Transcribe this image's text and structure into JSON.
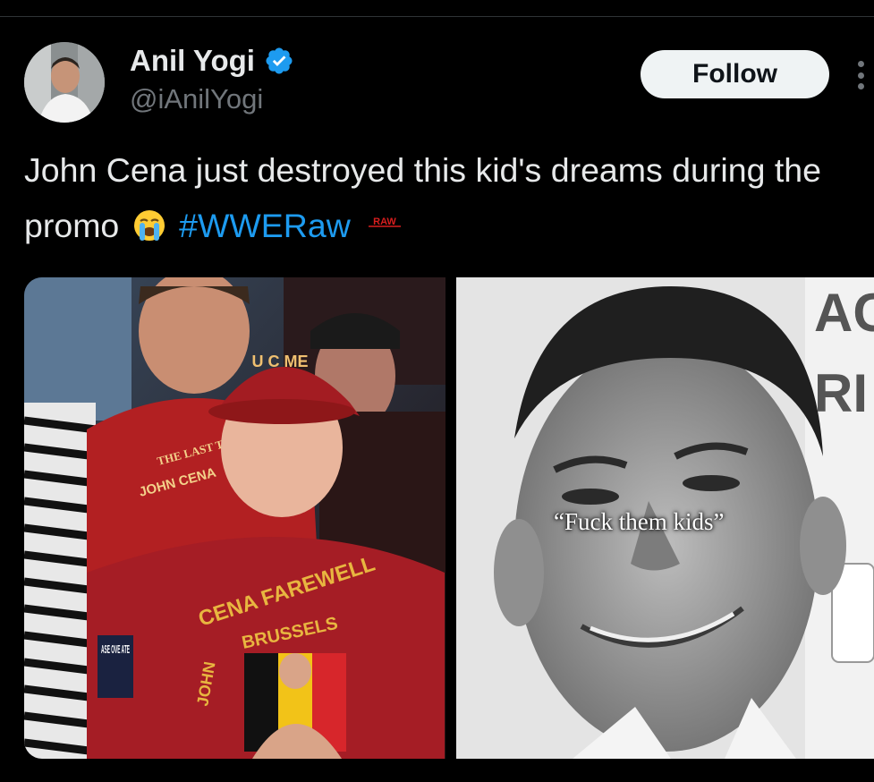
{
  "tweet": {
    "author": {
      "display_name": "Anil Yogi",
      "handle": "@iAnilYogi",
      "verified": true
    },
    "follow_label": "Follow",
    "text_main": "John Cena just destroyed this kid's dreams during the promo",
    "emoji": "loudly-crying-face",
    "hashtag": "#WWERaw",
    "hashtag_badge": "RAW",
    "media": {
      "left_image": {
        "cap_text": "U C ME",
        "shirt_text_top": "THE LAST TIME IS NOW",
        "shirt_text_name": "JOHN CENA",
        "kid_shirt_text_arc": "CENA FAREWELL",
        "kid_shirt_text_city": "BRUSSELS",
        "kid_shirt_text_side": "JOHN",
        "sign_text": "ASE OVE ATE"
      },
      "right_image": {
        "caption": "“Fuck them kids”"
      }
    }
  },
  "colors": {
    "background": "#000000",
    "text": "#e7e9ea",
    "secondary": "#71767b",
    "accent": "#1d9bf0",
    "follow_bg": "#eff3f4"
  }
}
